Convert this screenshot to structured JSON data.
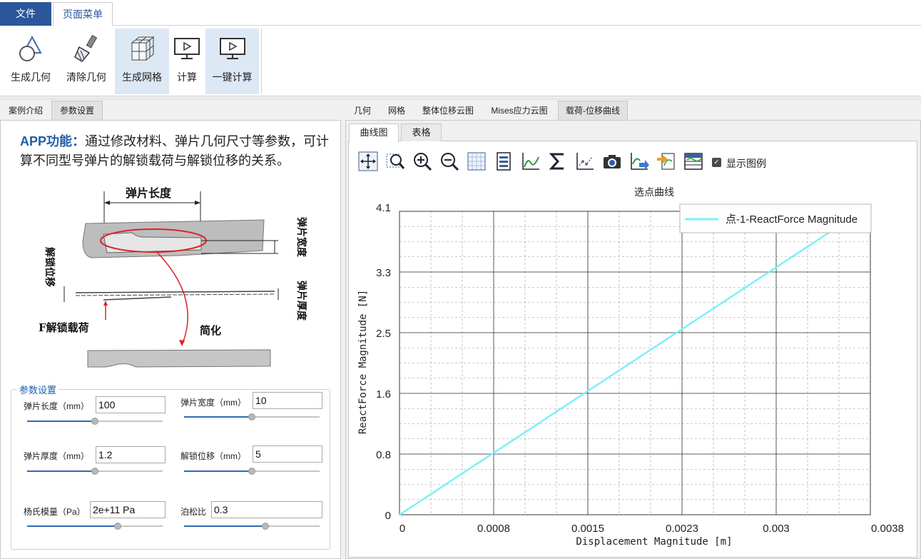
{
  "menu": {
    "file": "文件",
    "page_menu": "页面菜单"
  },
  "ribbon": {
    "gen_geometry": "生成几何",
    "clear_geometry": "清除几何",
    "gen_mesh": "生成网格",
    "compute": "计算",
    "one_click_compute": "一键计算"
  },
  "left_tabs": [
    "案例介绍",
    "参数设置"
  ],
  "intro": {
    "label": "APP功能：",
    "text": "通过修改材料、弹片几何尺寸等参数，可计算不同型号弹片的解锁载荷与解锁位移的关系。"
  },
  "diagram": {
    "length": "弹片长度",
    "width": "弹片宽度",
    "unlock_disp": "解锁位移",
    "thickness": "弹片厚度",
    "load": "F解锁载荷",
    "simplify": "简化"
  },
  "params": {
    "title": "参数设置",
    "items": [
      {
        "label": "弹片长度（mm）",
        "value": "100",
        "slider": 0.5
      },
      {
        "label": "弹片宽度（mm）",
        "value": "10",
        "slider": 0.5
      },
      {
        "label": "弹片厚度（mm）",
        "value": "1.2",
        "slider": 0.5
      },
      {
        "label": "解锁位移（mm）",
        "value": "5",
        "slider": 0.5
      },
      {
        "label": "杨氏模量（Pa）",
        "value": "2e+11 Pa",
        "slider": 0.67
      },
      {
        "label": "泊松比",
        "value": "0.3",
        "slider": 0.6
      }
    ]
  },
  "right_tabs": [
    "几何",
    "网格",
    "整体位移云图",
    "Mises应力云图",
    "载荷-位移曲线"
  ],
  "sub_tabs": [
    "曲线图",
    "表格"
  ],
  "toolbar": {
    "icons": [
      "pan-icon",
      "zoom-box-icon",
      "zoom-in-icon",
      "zoom-out-icon",
      "grid-icon",
      "page-icon",
      "curve-icon",
      "sum-icon",
      "dotted-curve-icon",
      "camera-icon",
      "export-curve-icon",
      "import-icon",
      "table-icon"
    ],
    "show_legend": "显示图例"
  },
  "chart_data": {
    "type": "line",
    "title": "选点曲线",
    "xlabel": "Displacement Magnitude [m]",
    "ylabel": "ReactForce Magnitude [N]",
    "xlim": [
      0,
      0.0038
    ],
    "ylim": [
      0,
      4.1
    ],
    "x_ticks": [
      "0",
      "0.0008",
      "0.0015",
      "0.0023",
      "0.003",
      "0.0038"
    ],
    "y_ticks": [
      "0",
      "0.8",
      "1.6",
      "2.5",
      "3.3",
      "4.1"
    ],
    "grid": true,
    "legend_position": "top-right",
    "series": [
      {
        "name": "点-1-ReactForce Magnitude",
        "color": "#7df0f5",
        "x": [
          0,
          0.0035
        ],
        "y": [
          0,
          3.85
        ]
      }
    ]
  }
}
